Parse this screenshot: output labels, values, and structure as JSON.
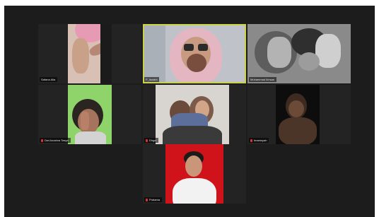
{
  "participants": [
    {
      "name": "Safana Aila",
      "muted": false
    },
    {
      "name": "P_Isnaini",
      "muted": false
    },
    {
      "name": "Muhammad Ikhsan",
      "muted": false
    },
    {
      "name": "Dwi Azzahra Tasya",
      "muted": true
    },
    {
      "name": "Dirga",
      "muted": true
    },
    {
      "name": "Imamsyah",
      "muted": true
    },
    {
      "name": "Pratama",
      "muted": true
    }
  ],
  "colors": {
    "window_bg": "#1c1c1c",
    "tile_bg": "#232323",
    "active_speaker_border": "#c9d24a",
    "mute_icon": "#e0312e",
    "green_backdrop": "#8fd46a",
    "red_backdrop": "#d0121a"
  },
  "active_speaker_index": 1
}
